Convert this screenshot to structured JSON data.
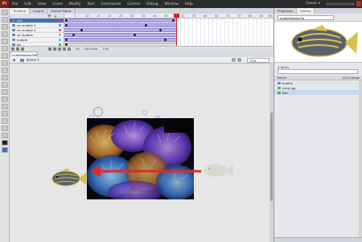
{
  "app": {
    "logo": "Fl",
    "menu": [
      "File",
      "Edit",
      "View",
      "Insert",
      "Modify",
      "Text",
      "Commands",
      "Control",
      "Debug",
      "Window",
      "Help"
    ],
    "workspace": "Classic ▾"
  },
  "timeline": {
    "tabs": [
      "Timeline",
      "Output",
      "Motion Editor"
    ],
    "layers": [
      {
        "name": "fish",
        "color": "#e24444",
        "selected": true
      },
      {
        "name": "sm bubble 3",
        "color": "#42a0ff",
        "selected": false
      },
      {
        "name": "sm bubble 2",
        "color": "#c85cff",
        "selected": false
      },
      {
        "name": "sm bubble",
        "color": "#ffb03a",
        "selected": false
      },
      {
        "name": "bubble",
        "color": "#42d2ff",
        "selected": false
      },
      {
        "name": "bg",
        "color": "#3ac24a",
        "selected": false
      }
    ],
    "ruler_labels": [
      "5",
      "10",
      "15",
      "20",
      "25",
      "30",
      "35",
      "40",
      "45",
      "50",
      "55",
      "60",
      "65",
      "70",
      "75",
      "80",
      "85",
      "90"
    ],
    "current_frame": "50",
    "fps": "24.00 fps",
    "time": "2.0s"
  },
  "document": {
    "tab": "underthesea.fla*",
    "scene": "Scene 1",
    "zoom": "75%"
  },
  "library": {
    "tabs": [
      "Properties",
      "Library"
    ],
    "document_select": "underthesea.fla",
    "item_count": "4 items",
    "header_name": "Name",
    "header_linkage": "AS Linkage",
    "items": [
      {
        "name": "bubble",
        "type": "symbol",
        "indent": false
      },
      {
        "name": "coral.jpg",
        "type": "bitmap",
        "indent": false
      },
      {
        "name": "fish",
        "type": "graphic",
        "indent": false
      }
    ]
  },
  "colors": {
    "accent": "#3f6eb6",
    "playhead": "#e02020",
    "arrow": "#e8262a",
    "tween": "#b7aee8"
  }
}
